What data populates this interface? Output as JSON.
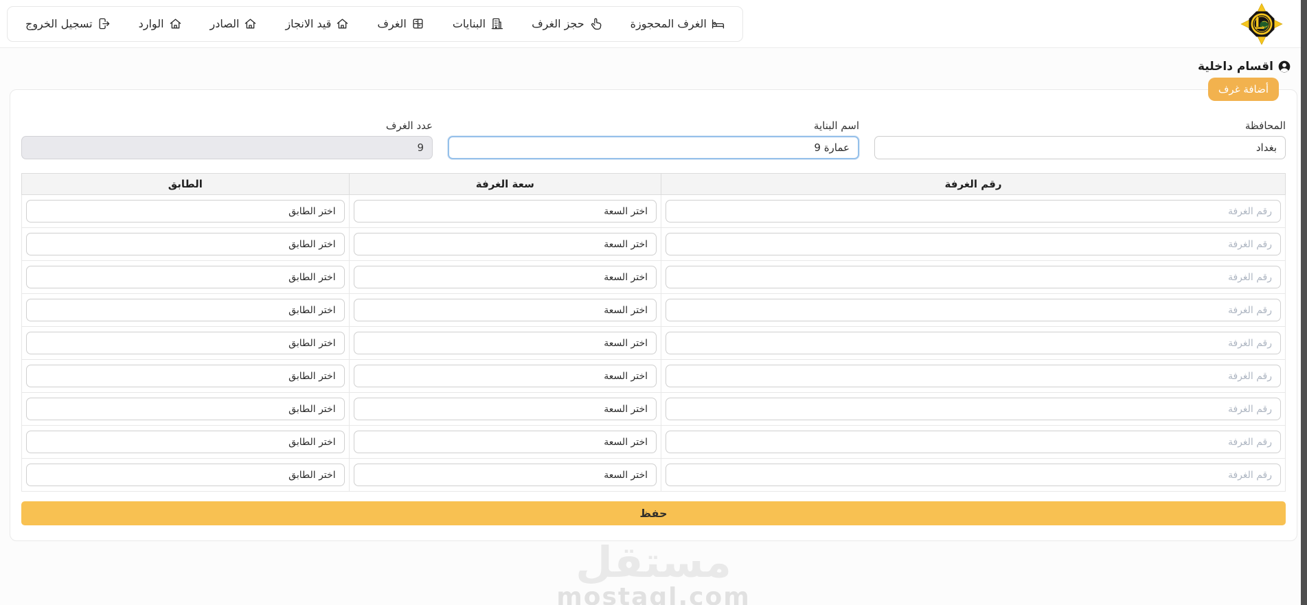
{
  "nav": {
    "items": [
      {
        "label": "الغرف المحجوزة",
        "icon": "reserved-rooms-icon"
      },
      {
        "label": "حجز الغرف",
        "icon": "book-rooms-icon"
      },
      {
        "label": "البنايات",
        "icon": "buildings-icon"
      },
      {
        "label": "الغرف",
        "icon": "rooms-icon"
      },
      {
        "label": "قيد الانجاز",
        "icon": "in-progress-icon"
      },
      {
        "label": "الصادر",
        "icon": "outgoing-icon"
      },
      {
        "label": "الوارد",
        "icon": "incoming-icon"
      },
      {
        "label": "تسجيل الخروج",
        "icon": "logout-icon"
      }
    ]
  },
  "page": {
    "section_title": "اقسام داخلية",
    "add_rooms_button": "أضافة غرف"
  },
  "form": {
    "governorate": {
      "label": "المحافظة",
      "value": "بغداد"
    },
    "building_name": {
      "label": "اسم البناية",
      "value": "عمارة 9"
    },
    "rooms_count": {
      "label": "عدد الغرف",
      "value": "9"
    }
  },
  "table": {
    "headers": {
      "room_number": "رقم الغرفة",
      "room_capacity": "سعة الغرفة",
      "floor": "الطابق"
    },
    "row_count": 9,
    "row_template": {
      "room_number_placeholder": "رقم الغرفة",
      "capacity_select": "اختر السعة",
      "floor_select": "اختر الطابق"
    }
  },
  "actions": {
    "save_label": "حفظ"
  },
  "watermark": {
    "logo_text": "مستقل",
    "site": "mostaql.com"
  },
  "colors": {
    "accent_orange": "#f2b24e",
    "save_orange": "#f8c152",
    "focus_blue": "#95c0ea",
    "disabled_bg": "#e9e9ed"
  }
}
